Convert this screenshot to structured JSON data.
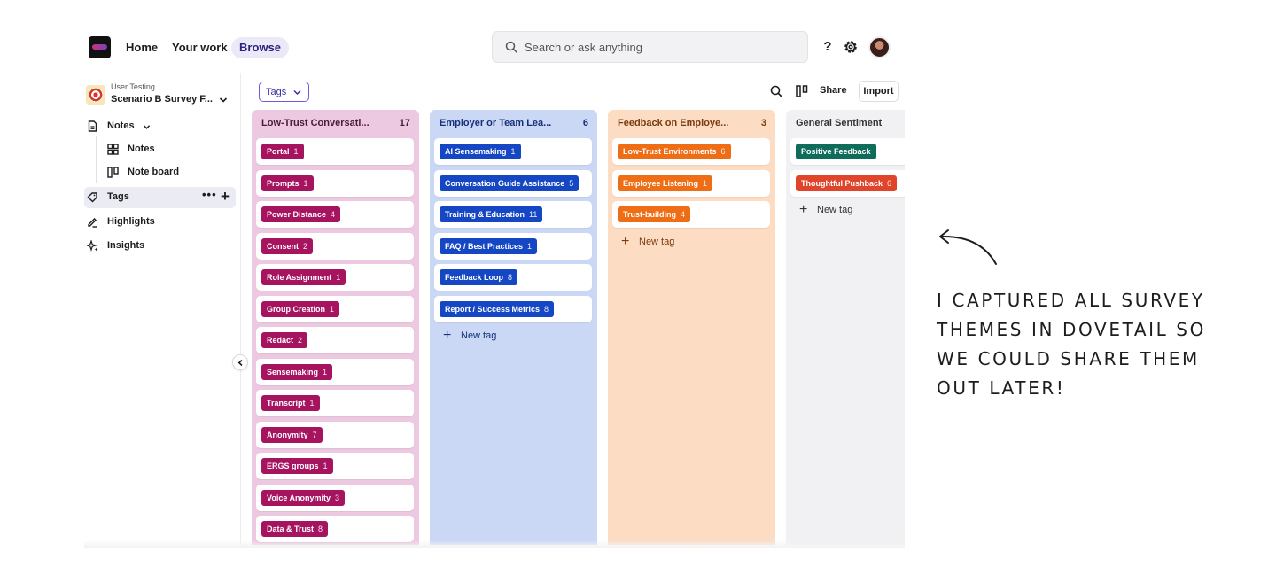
{
  "nav": {
    "home": "Home",
    "your_work": "Your work",
    "browse": "Browse",
    "search_placeholder": "Search or ask anything",
    "help": "?"
  },
  "sidebar": {
    "project_subtitle": "User Testing",
    "project_name": "Scenario B Survey F...",
    "notes": "Notes",
    "notes_sub": "Notes",
    "note_board": "Note board",
    "tags": "Tags",
    "tags_more": "•••",
    "tags_add": "+",
    "highlights": "Highlights",
    "insights": "Insights"
  },
  "toolbar": {
    "tags_filter": "Tags",
    "share": "Share",
    "import": "Import"
  },
  "columns": [
    {
      "title": "Low-Trust Conversati...",
      "count": "17",
      "color": "#a6135f",
      "tags": [
        {
          "label": "Portal",
          "count": "1"
        },
        {
          "label": "Prompts",
          "count": "1"
        },
        {
          "label": "Power Distance",
          "count": "4"
        },
        {
          "label": "Consent",
          "count": "2"
        },
        {
          "label": "Role Assignment",
          "count": "1"
        },
        {
          "label": "Group Creation",
          "count": "1"
        },
        {
          "label": "Redact",
          "count": "2"
        },
        {
          "label": "Sensemaking",
          "count": "1"
        },
        {
          "label": "Transcript",
          "count": "1"
        },
        {
          "label": "Anonymity",
          "count": "7"
        },
        {
          "label": "ERGS groups",
          "count": "1"
        },
        {
          "label": "Voice Anonymity",
          "count": "3"
        },
        {
          "label": "Data & Trust",
          "count": "8"
        }
      ]
    },
    {
      "title": "Employer or Team Lea...",
      "count": "6",
      "color": "#1546c4",
      "tags": [
        {
          "label": "AI Sensemaking",
          "count": "1"
        },
        {
          "label": "Conversation Guide Assistance",
          "count": "5"
        },
        {
          "label": "Training & Education",
          "count": "11"
        },
        {
          "label": "FAQ / Best Practices",
          "count": "1"
        },
        {
          "label": "Feedback Loop",
          "count": "8"
        },
        {
          "label": "Report / Success Metrics",
          "count": "8"
        }
      ],
      "new_tag": "New tag"
    },
    {
      "title": "Feedback on Employe...",
      "count": "3",
      "color": "#ef6d14",
      "tags": [
        {
          "label": "Low-Trust Environments",
          "count": "6"
        },
        {
          "label": "Employee Listening",
          "count": "1"
        },
        {
          "label": "Trust-building",
          "count": "4"
        }
      ],
      "new_tag": "New tag"
    },
    {
      "title": "General Sentiment",
      "tags": [
        {
          "label": "Positive Feedback",
          "count": "",
          "color": "#0f6b5a"
        },
        {
          "label": "Thoughtful Pushback",
          "count": "6",
          "color": "#e0452c"
        }
      ],
      "new_tag": "New tag"
    }
  ],
  "annotation": {
    "lines": [
      "I CAPTURED ALL SURVEY",
      "THEMES IN DOVETAIL SO",
      "WE COULD SHARE THEM",
      "OUT LATER!"
    ]
  }
}
